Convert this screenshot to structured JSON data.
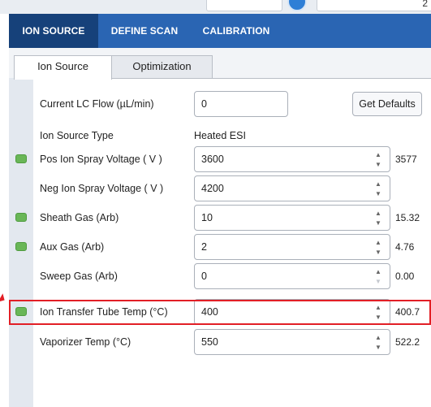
{
  "top_strip": {
    "field_value": "2"
  },
  "main_tabs": [
    {
      "label": "ION SOURCE",
      "active": true
    },
    {
      "label": "DEFINE SCAN",
      "active": false
    },
    {
      "label": "CALIBRATION",
      "active": false
    }
  ],
  "sub_tabs": [
    {
      "label": "Ion Source",
      "active": true
    },
    {
      "label": "Optimization",
      "active": false
    }
  ],
  "lc_flow": {
    "label": "Current LC Flow (µL/min)",
    "value": "0",
    "button_label": "Get Defaults"
  },
  "ion_source_type": {
    "label": "Ion Source Type",
    "value": "Heated ESI"
  },
  "parameters": [
    {
      "label": "Pos Ion Spray Voltage ( V )",
      "value": "3600",
      "readback": "3577",
      "status": "green"
    },
    {
      "label": "Neg Ion Spray Voltage ( V )",
      "value": "4200",
      "readback": "",
      "status": "none"
    },
    {
      "label": "Sheath Gas (Arb)",
      "value": "10",
      "readback": "15.32",
      "status": "green"
    },
    {
      "label": "Aux Gas (Arb)",
      "value": "2",
      "readback": "4.76",
      "status": "green"
    },
    {
      "label": "Sweep Gas (Arb)",
      "value": "0",
      "readback": "0.00",
      "status": "none"
    },
    {
      "label": "Ion Transfer Tube Temp (°C)",
      "value": "400",
      "readback": "400.7",
      "status": "green",
      "highlighted": true
    },
    {
      "label": "Vaporizer Temp (°C)",
      "value": "550",
      "readback": "522.2",
      "status": "none"
    }
  ],
  "colors": {
    "tab_bar": "#2a65b3",
    "tab_active": "#16417a",
    "status_green": "#69b657",
    "highlight_red": "#e21f26"
  },
  "icons": {
    "spinner_up": "▲",
    "spinner_down": "▼"
  }
}
